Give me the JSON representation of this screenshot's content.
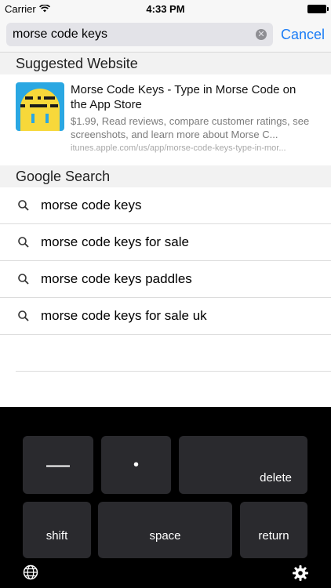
{
  "status_bar": {
    "carrier": "Carrier",
    "time": "4:33 PM"
  },
  "search": {
    "value": "morse code keys",
    "cancel_label": "Cancel"
  },
  "suggested": {
    "header": "Suggested Website",
    "title": "Morse Code Keys - Type in Morse Code on the App Store",
    "description": "$1.99, Read reviews, compare customer ratings, see screenshots, and learn more about Morse C...",
    "url": "itunes.apple.com/us/app/morse-code-keys-type-in-mor..."
  },
  "google": {
    "header": "Google Search",
    "results": [
      "morse code keys",
      "morse code keys for sale",
      "morse code keys paddles",
      "morse code keys for sale uk"
    ]
  },
  "keyboard": {
    "dash_label": "—",
    "dot_label": "•",
    "delete_label": "delete",
    "shift_label": "shift",
    "space_label": "space",
    "return_label": "return",
    "globe_icon": "globe-icon",
    "gear_icon": "gear-icon"
  }
}
